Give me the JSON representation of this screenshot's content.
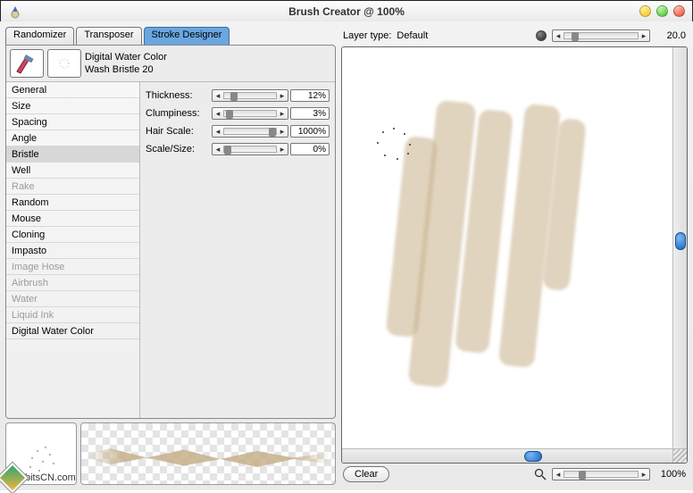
{
  "window": {
    "title": "Brush Creator @ 100%"
  },
  "tabs": {
    "randomizer": "Randomizer",
    "transposer": "Transposer",
    "strokeDesigner": "Stroke Designer",
    "active": "strokeDesigner"
  },
  "brush": {
    "category": "Digital Water Color",
    "variant": "Wash Bristle 20"
  },
  "categories": [
    {
      "label": "General",
      "enabled": true
    },
    {
      "label": "Size",
      "enabled": true
    },
    {
      "label": "Spacing",
      "enabled": true
    },
    {
      "label": "Angle",
      "enabled": true
    },
    {
      "label": "Bristle",
      "enabled": true,
      "selected": true
    },
    {
      "label": "Well",
      "enabled": true
    },
    {
      "label": "Rake",
      "enabled": false
    },
    {
      "label": "Random",
      "enabled": true
    },
    {
      "label": "Mouse",
      "enabled": true
    },
    {
      "label": "Cloning",
      "enabled": true
    },
    {
      "label": "Impasto",
      "enabled": true
    },
    {
      "label": "Image Hose",
      "enabled": false
    },
    {
      "label": "Airbrush",
      "enabled": false
    },
    {
      "label": "Water",
      "enabled": false
    },
    {
      "label": "Liquid Ink",
      "enabled": false
    },
    {
      "label": "Digital Water Color",
      "enabled": true
    }
  ],
  "params": {
    "thickness": {
      "label": "Thickness:",
      "value": "12%",
      "pos": 12
    },
    "clumpiness": {
      "label": "Clumpiness:",
      "value": "3%",
      "pos": 3
    },
    "hairScale": {
      "label": "Hair Scale:",
      "value": "1000%",
      "pos": 100
    },
    "scaleSize": {
      "label": "Scale/Size:",
      "value": "0%",
      "pos": 0
    }
  },
  "rightPanel": {
    "layerTypeLabel": "Layer type:",
    "layerTypeValue": "Default",
    "sizeValue": "20.0",
    "zoomValue": "100%",
    "clearLabel": "Clear"
  },
  "watermark": "bitsCN.com"
}
